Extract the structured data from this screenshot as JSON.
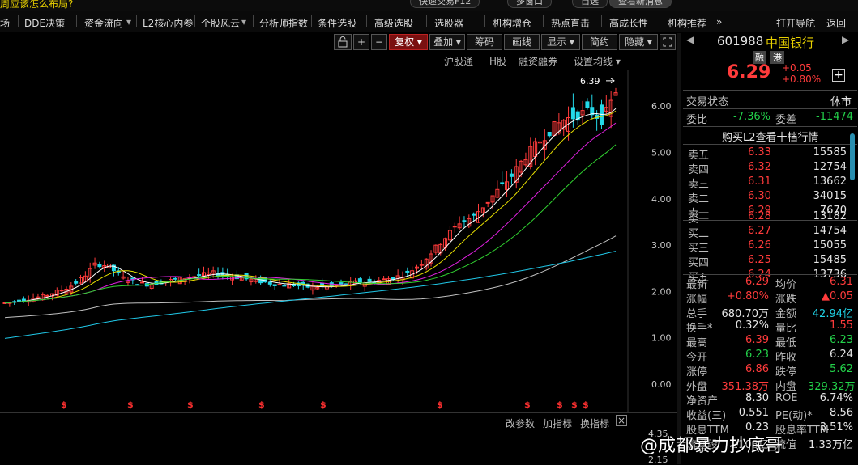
{
  "top_strip": {
    "ticker": "周应该怎么布局?",
    "pills": [
      "快速交易F12",
      "多窗口",
      "自选",
      "查看新消息"
    ]
  },
  "menu": {
    "items": [
      "场",
      "DDE决策",
      "资金流向",
      "L2核心内参",
      "个股风云",
      "分析师指数",
      "条件选股",
      "高级选股",
      "选股器",
      "机构增仓",
      "热点直击",
      "高成长性",
      "机构推荐",
      "»",
      "打开导航",
      "返回"
    ]
  },
  "chart_toolbar": {
    "lock_icon": "🔒",
    "zoom_in": "+",
    "zoom_out": "−",
    "restore": "复权",
    "overlay": "叠加",
    "chips": "筹码",
    "draw": "画线",
    "display": "显示",
    "simple": "简约",
    "hide": "隐藏",
    "fullscreen_icon": "⛶"
  },
  "sub_toolbar": {
    "items": [
      "沪股通",
      "H股",
      "融资融券",
      "设置均线"
    ]
  },
  "lower_toolbar": {
    "items": [
      "改参数",
      "加指标",
      "换指标"
    ],
    "close": "×"
  },
  "lower_axis": {
    "top": "4.35",
    "bottom": "2.15"
  },
  "quote": {
    "code": "601988",
    "name": "中国银行",
    "tag_margin": "融",
    "tag_hk": "港",
    "price": "6.29",
    "change": "+0.05",
    "change_pct": "+0.80%",
    "add_label": "+",
    "status_label": "交易状态",
    "status_value": "休市",
    "ratio_label": "委比",
    "ratio_value": "-7.36%",
    "diff_label": "委差",
    "diff_value": "-11474",
    "l2_link": "购买L2查看十档行情",
    "asks": [
      {
        "label": "卖五",
        "price": "6.33",
        "vol": "15585"
      },
      {
        "label": "卖四",
        "price": "6.32",
        "vol": "12754"
      },
      {
        "label": "卖三",
        "price": "6.31",
        "vol": "13662"
      },
      {
        "label": "卖二",
        "price": "6.30",
        "vol": "34015"
      },
      {
        "label": "卖一",
        "price": "6.29",
        "vol": "7670"
      }
    ],
    "bids": [
      {
        "label": "买一",
        "price": "6.28",
        "vol": "13182"
      },
      {
        "label": "买二",
        "price": "6.27",
        "vol": "14754"
      },
      {
        "label": "买三",
        "price": "6.26",
        "vol": "15055"
      },
      {
        "label": "买四",
        "price": "6.25",
        "vol": "15485"
      },
      {
        "label": "买五",
        "price": "6.24",
        "vol": "13736"
      }
    ],
    "stats": [
      {
        "l1": "最新",
        "v1": "6.29",
        "c1": "red",
        "l2": "均价",
        "v2": "6.31",
        "c2": "red"
      },
      {
        "l1": "涨幅",
        "v1": "+0.80%",
        "c1": "red",
        "l2": "涨跌",
        "v2": "▲0.05",
        "c2": "red"
      },
      {
        "l1": "总手",
        "v1": "680.70万",
        "c1": "white",
        "l2": "金额",
        "v2": "42.94亿",
        "c2": "cyan"
      },
      {
        "l1": "换手*",
        "v1": "0.32%",
        "c1": "white",
        "l2": "量比",
        "v2": "1.55",
        "c2": "red"
      },
      {
        "l1": "最高",
        "v1": "6.39",
        "c1": "red",
        "l2": "最低",
        "v2": "6.23",
        "c2": "green"
      },
      {
        "l1": "今开",
        "v1": "6.23",
        "c1": "green",
        "l2": "昨收",
        "v2": "6.24",
        "c2": "white"
      },
      {
        "l1": "涨停",
        "v1": "6.86",
        "c1": "red",
        "l2": "跌停",
        "v2": "5.62",
        "c2": "green"
      },
      {
        "l1": "外盘",
        "v1": "351.38万",
        "c1": "red",
        "l2": "内盘",
        "v2": "329.32万",
        "c2": "green"
      },
      {
        "l1": "净资产",
        "v1": "8.30",
        "c1": "white",
        "l2": "ROE",
        "v2": "6.74%",
        "c2": "white"
      },
      {
        "l1": "收益(三)",
        "v1": "0.551",
        "c1": "white",
        "l2": "PE(动)*",
        "v2": "8.56",
        "c2": "white"
      },
      {
        "l1": "股息TTM",
        "v1": "0.23",
        "c1": "white",
        "l2": "股息率TTM",
        "v2": "3.51%",
        "c2": "white"
      },
      {
        "l1": "流通股",
        "v1": "2108亿",
        "c1": "white",
        "l2": "流值",
        "v2": "1.33万亿",
        "c2": "white"
      }
    ]
  },
  "watermark": "@成都暴力抄底哥",
  "colors": {
    "up": "#ff3b3b",
    "down": "#23d8e8",
    "ma5": "#ffffff",
    "ma10": "#e8e000",
    "ma20": "#e020e0",
    "ma30": "#30d030",
    "ma60": "#c0c0c0",
    "ma120": "#20c8e8"
  },
  "chart_data": {
    "type": "candlestick",
    "y_ticks": [
      "6.00",
      "5.00",
      "4.00",
      "3.00",
      "2.00",
      "1.00",
      "0.00"
    ],
    "ylim": [
      0,
      6.6
    ],
    "high_label": "6.39",
    "latest": {
      "open": 6.23,
      "high": 6.39,
      "low": 6.23,
      "close": 6.29
    },
    "dividend_marker": "$",
    "dividend_marker_count": 9,
    "close_series_approx": [
      1.75,
      1.8,
      1.85,
      1.9,
      2.0,
      2.1,
      2.3,
      2.6,
      2.55,
      2.3,
      2.2,
      2.15,
      2.2,
      2.25,
      2.3,
      2.35,
      2.4,
      2.35,
      2.3,
      2.25,
      2.2,
      2.15,
      2.15,
      2.1,
      2.1,
      2.1,
      2.15,
      2.2,
      2.2,
      2.25,
      2.3,
      2.4,
      2.6,
      2.9,
      3.2,
      3.5,
      3.6,
      3.9,
      4.2,
      4.5,
      4.9,
      5.2,
      5.5,
      5.7,
      5.8,
      5.9,
      5.7,
      6.29
    ]
  }
}
